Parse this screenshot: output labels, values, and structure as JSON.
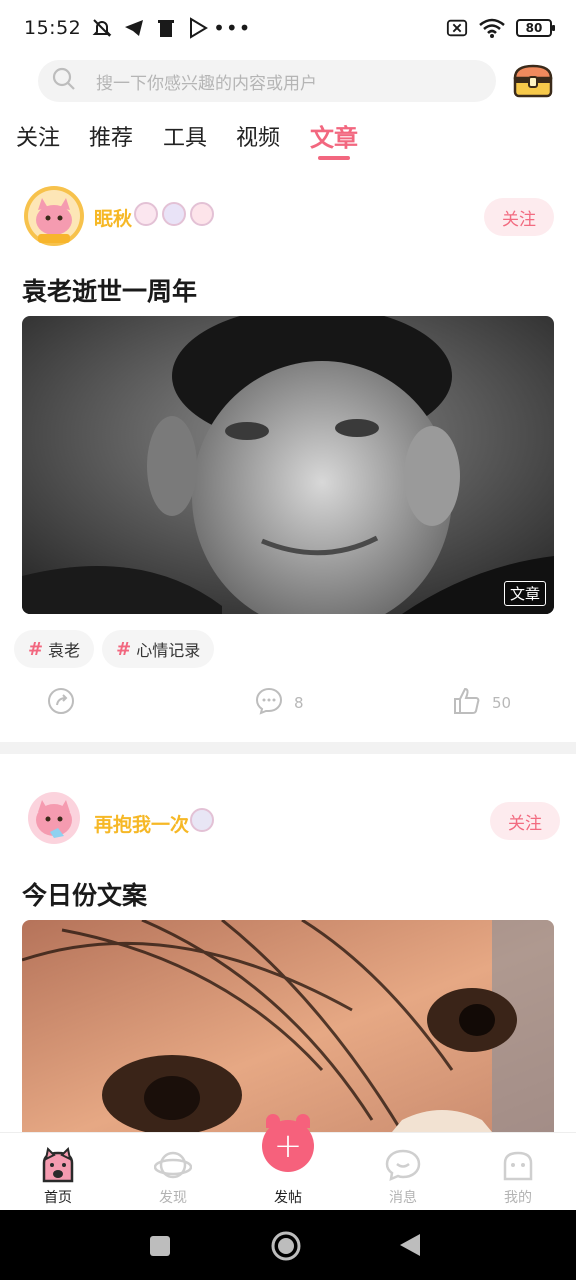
{
  "status_bar": {
    "time": "15:52",
    "battery": "80",
    "left_icons": [
      "mute-icon",
      "telegram-icon",
      "trash-icon",
      "play-store-icon",
      "more-dots-icon"
    ],
    "right_icons": [
      "no-sim-icon",
      "wifi-icon",
      "battery-icon"
    ]
  },
  "search": {
    "placeholder": "搜一下你感兴趣的内容或用户"
  },
  "tabs": [
    {
      "label": "关注",
      "active": false
    },
    {
      "label": "推荐",
      "active": false
    },
    {
      "label": "工具",
      "active": false
    },
    {
      "label": "视频",
      "active": false
    },
    {
      "label": "文章",
      "active": true
    }
  ],
  "posts": [
    {
      "username": "眠秋",
      "follow_label": "关注",
      "title": "袁老逝世一周年",
      "image_tag": "文章",
      "topics": [
        "袁老",
        "心情记录"
      ],
      "comments": "8",
      "likes": "50"
    },
    {
      "username": "再抱我一次",
      "follow_label": "关注",
      "title": "今日份文案"
    }
  ],
  "bottom_nav": [
    {
      "label": "首页",
      "active": true
    },
    {
      "label": "发现",
      "active": false
    },
    {
      "label": "发帖",
      "active": false
    },
    {
      "label": "消息",
      "active": false
    },
    {
      "label": "我的",
      "active": false
    }
  ],
  "colors": {
    "accent": "#f2677f",
    "username": "#f6b826",
    "follow_bg": "#fdebee"
  }
}
